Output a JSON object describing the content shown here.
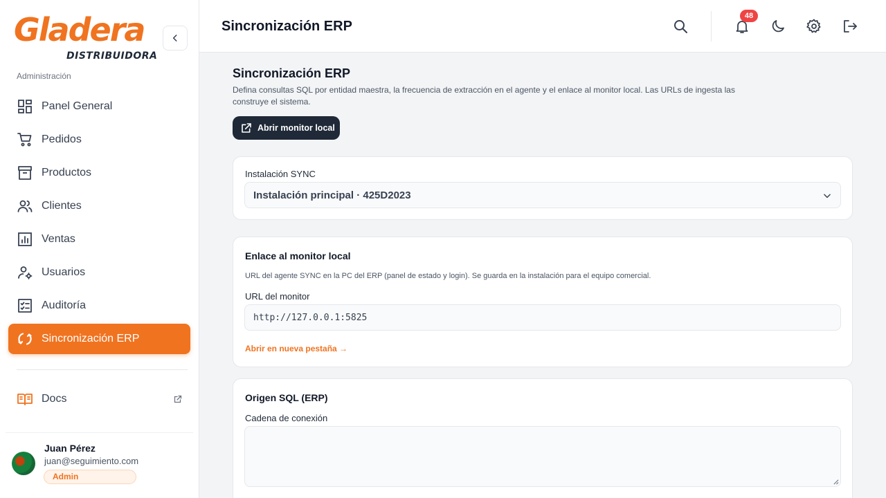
{
  "brand": {
    "logo_text": "Gladera",
    "logo_sub": "DISTRIBUIDORA",
    "accent": "#f07320"
  },
  "sidebar": {
    "section_label": "Administración",
    "items": [
      {
        "label": "Panel General",
        "icon": "dashboard-icon"
      },
      {
        "label": "Pedidos",
        "icon": "cart-icon"
      },
      {
        "label": "Productos",
        "icon": "archive-icon"
      },
      {
        "label": "Clientes",
        "icon": "users-icon"
      },
      {
        "label": "Ventas",
        "icon": "chart-icon"
      },
      {
        "label": "Usuarios",
        "icon": "user-gear-icon"
      },
      {
        "label": "Auditoría",
        "icon": "checklist-icon"
      },
      {
        "label": "Sincronización ERP",
        "icon": "sync-icon",
        "active": true
      }
    ],
    "docs_label": "Docs"
  },
  "user": {
    "name": "Juan Pérez",
    "email": "juan@seguimiento.com",
    "role": "Admin"
  },
  "header": {
    "title": "Sincronización ERP",
    "notification_count": "48"
  },
  "page": {
    "title": "Sincronización ERP",
    "description": "Defina consultas SQL por entidad maestra, la frecuencia de extracción en el agente y el enlace al monitor local. Las URLs de ingesta las construye el sistema.",
    "monitor_button": "Abrir monitor local"
  },
  "install_card": {
    "label": "Instalación SYNC",
    "selected": "Instalación principal · 425D2023"
  },
  "monitor_card": {
    "title": "Enlace al monitor local",
    "hint": "URL del agente SYNC en la PC del ERP (panel de estado y login). Se guarda en la instalación para el equipo comercial.",
    "field_label": "URL del monitor",
    "field_value": "http://127.0.0.1:5825",
    "link": "Abrir en nueva pestaña →"
  },
  "sql_card": {
    "title": "Origen SQL (ERP)",
    "field_label": "Cadena de conexión",
    "field_value": ""
  }
}
